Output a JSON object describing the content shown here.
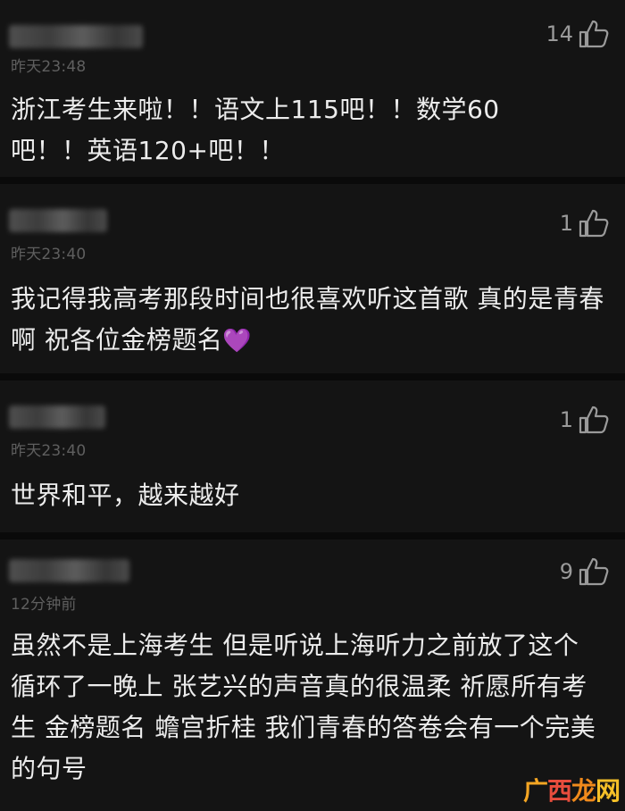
{
  "comments": [
    {
      "timestamp": "昨天23:48",
      "likes": "14",
      "text": "浙江考生来啦！！语文上115吧！！数学60吧！！英语120+吧！！"
    },
    {
      "timestamp": "昨天23:40",
      "likes": "1",
      "text": "我记得我高考那段时间也很喜欢听这首歌 真的是青春啊 祝各位金榜题名",
      "emoji": "💜"
    },
    {
      "timestamp": "昨天23:40",
      "likes": "1",
      "text": "世界和平，越来越好"
    },
    {
      "timestamp": "12分钟前",
      "likes": "9",
      "text": "虽然不是上海考生 但是听说上海听力之前放了这个 循环了一晚上 张艺兴的声音真的很温柔 祈愿所有考生 金榜题名 蟾宫折桂 我们青春的答卷会有一个完美的句号"
    }
  ],
  "watermark": {
    "c1": "广",
    "c2": "西",
    "c3": "龙",
    "c4": "网"
  },
  "icons": {
    "like": "thumbs-up-icon"
  }
}
